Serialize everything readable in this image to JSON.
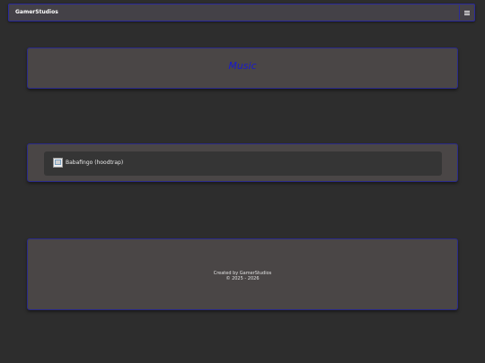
{
  "navbar": {
    "brand": "GamerStudios",
    "menu_icon": "hamburger-menu-icon"
  },
  "page": {
    "title": "Music"
  },
  "tracks": [
    {
      "label": "Babafingo (hoodtrap)",
      "thumbnail_icon": "broken-image-icon"
    }
  ],
  "footer": {
    "line1": "Created by GamerStudios",
    "line2": "© 2025 - 2026"
  },
  "colors": {
    "background": "#2d2d2d",
    "panel": "#4a4646",
    "panel_border": "#2a2a8a",
    "title_text": "#1a1acc",
    "track_bg": "#353535"
  }
}
